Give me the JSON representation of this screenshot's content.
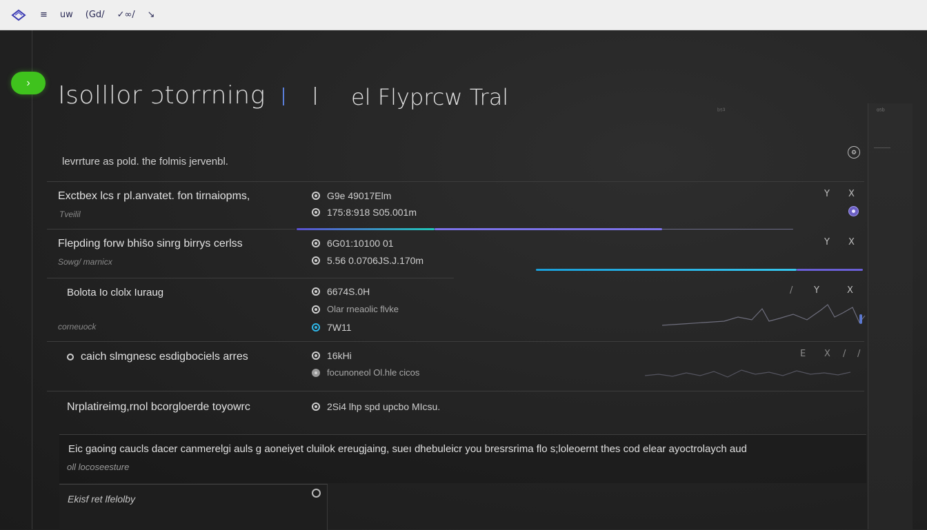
{
  "topbar": {
    "icon": "diamond-logo-icon",
    "items": [
      "≡",
      "uw",
      "(Gd/",
      "✓∞/",
      "↘"
    ]
  },
  "go_button": {
    "label": "›",
    "color": "#3fc21d"
  },
  "header": {
    "title_left": "Isolllor ɔtorrning",
    "title_right": "el Flyprcw Tral",
    "faint_label": "ᵇ⁵³",
    "top_icon": "⚙",
    "subtitle": "levrrture as pold. the folmis jervenbl."
  },
  "sidepanel": {
    "label": "ᵅ⁵ᵇ"
  },
  "rows": [
    {
      "title": "Exctbex lcs r pl.anvatet. fon tirnaiopms,",
      "sub": "Tveilil",
      "specs": [
        "G9e 49017Elm",
        "175:8:918 S05.001m"
      ],
      "marks": [
        "Y",
        "X"
      ]
    },
    {
      "title": "Flepding forw bhis̄o sinrg birrys cerlss",
      "sub": "Sowg/ marnicx",
      "specs": [
        "6G01:10100 01",
        "5.56 0.0706JS.J.170m"
      ],
      "marks": [
        "Y",
        "X"
      ]
    },
    {
      "title": "Bolota Io clolx Iuraug",
      "sub": "corneuock",
      "specs": [
        "6674S.0H",
        "Olar rneaolic flvke",
        "7W11"
      ],
      "marks": [
        "/",
        "Y",
        "X"
      ]
    },
    {
      "title": "caich slmgnesc esdigbociels arres",
      "specs": [
        "16kHi",
        "focunoneol Ol.hle cicos"
      ],
      "marks": [
        "E",
        "X",
        "/",
        "/"
      ]
    },
    {
      "title": "Nrplatireimg,rnol bcorgloerde toyowrc",
      "specs": [
        "2Si4 lhp spd upcbo MIcsu."
      ]
    }
  ],
  "bottom": {
    "text": "Eic gaoing caucls  dacer canmerelgi auls g aoneiyet cluilok ereugjaing, sueı dhebuleicr you bresrsrima flo s;loleoernt thes cod elear ayoctrolaych aud",
    "sub": "oll locoseesture"
  },
  "footer": {
    "label": "Ekisf ret lfelolby"
  },
  "colors": {
    "accent_green": "#3fc21d",
    "accent_purple": "#6b5fc4",
    "accent_cyan": "#2fb7e8",
    "background": "#232323"
  }
}
